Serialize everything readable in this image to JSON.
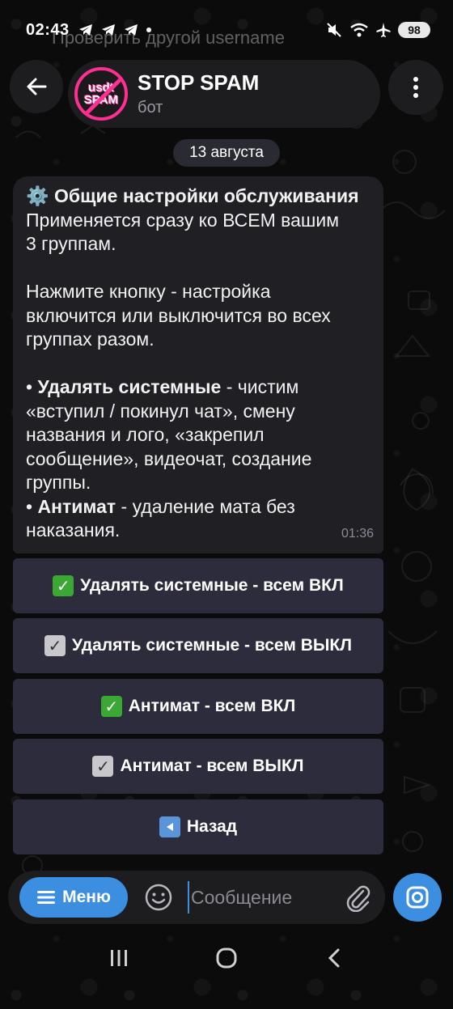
{
  "status_bar": {
    "time": "02:43",
    "battery": "98",
    "background_notice": "Проверить другой username"
  },
  "header": {
    "title": "STOP SPAM",
    "subtitle": "бот",
    "avatar_line1": "usdt",
    "avatar_line2": "SPAM"
  },
  "chat": {
    "date_chip": "13 августа",
    "message": {
      "title_emoji": "⚙️",
      "title": "Общие настройки обслуживания",
      "line1": "Применяется сразу ко ВСЕМ вашим",
      "line2": "3 группам.",
      "line3": "Нажмите кнопку - настройка",
      "line4": "включится или выключится во всех",
      "line5": "группах разом.",
      "bullet1_prefix": "• ",
      "bullet1_bold": "Удалять системные",
      "bullet1_rest1": " - чистим",
      "bullet1_rest2": "«вступил / покинул чат», смену",
      "bullet1_rest3": "названия и лого, «закрепил",
      "bullet1_rest4": "сообщение», видеочат, создание",
      "bullet1_rest5": "группы.",
      "bullet2_prefix": "• ",
      "bullet2_bold": "Антимат",
      "bullet2_rest1": " - удаление мата без",
      "bullet2_rest2": "наказания.",
      "time": "01:36"
    },
    "buttons": [
      {
        "label": "Удалять системные - всем ВКЛ",
        "icon": "green-check-icon"
      },
      {
        "label": "Удалять системные - всем ВЫКЛ",
        "icon": "grey-check-icon"
      },
      {
        "label": "Антимат - всем ВКЛ",
        "icon": "green-check-icon"
      },
      {
        "label": "Антимат - всем ВЫКЛ",
        "icon": "grey-check-icon"
      },
      {
        "label": "Назад",
        "icon": "back-arrow-icon"
      }
    ]
  },
  "input_bar": {
    "menu_label": "Меню",
    "placeholder": "Сообщение"
  },
  "colors": {
    "accent": "#3b8ee0",
    "bubble": "#1f1f24",
    "button": "#2c2c3c",
    "avatar_ring": "#ff2e93"
  }
}
